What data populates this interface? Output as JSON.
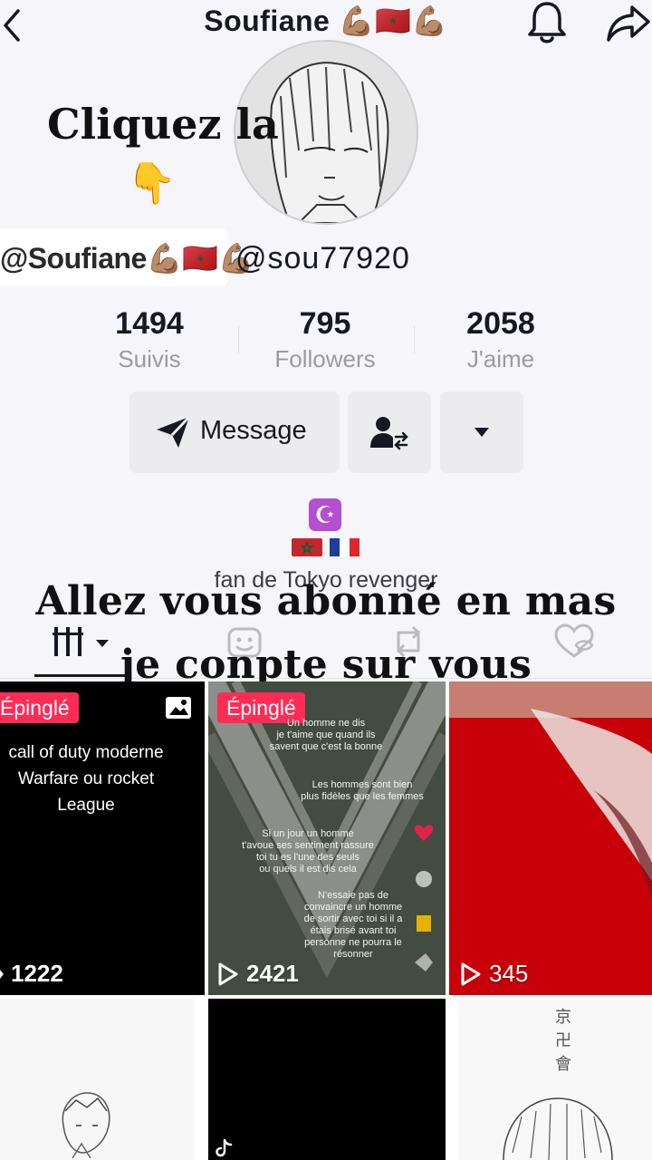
{
  "header": {
    "title": "Soufiane 💪🏽🇲🇦💪🏽"
  },
  "overlay": {
    "cliquez": "Cliquez la",
    "finger": "👇",
    "line1": "Allez vous abonné en mas",
    "line2": "je conpte sur vous"
  },
  "profile": {
    "display_name": "@Soufiane💪🏽🇲🇦💪🏽",
    "handle": "@sou77920",
    "bio_emoji": "☪",
    "bio_text": "fan de Tokyo revenger"
  },
  "stats": [
    {
      "value": "1494",
      "label": "Suivis"
    },
    {
      "value": "795",
      "label": "Followers"
    },
    {
      "value": "2058",
      "label": "J'aime"
    }
  ],
  "actions": {
    "message_label": "Message"
  },
  "videos": [
    {
      "pinned": "Épinglé",
      "caption": "call of duty moderne Warfare ou rocket League",
      "views": "1222"
    },
    {
      "pinned": "Épinglé",
      "caption_lines": [
        "Un homme ne dis",
        "je t'aime que quand ils",
        "savent que c'est la bonne",
        "Les hommes sont bien",
        "plus fidèles que les femmes",
        "Si un jour un homme",
        "t'avoue ses sentiment rassure",
        "toi tu es l'une des seuls",
        "ou quels il est dis cela",
        "N'essaie pas de",
        "convaincre un homme",
        "de sortir avec toi si il a",
        "étais brisé avant toi",
        "personne ne pourra le",
        "résonner"
      ],
      "views": "2421"
    },
    {
      "views": "345"
    }
  ],
  "colors": {
    "accent": "#fe2c55",
    "background": "#f6f5f9",
    "muted": "#9a9ba0"
  }
}
